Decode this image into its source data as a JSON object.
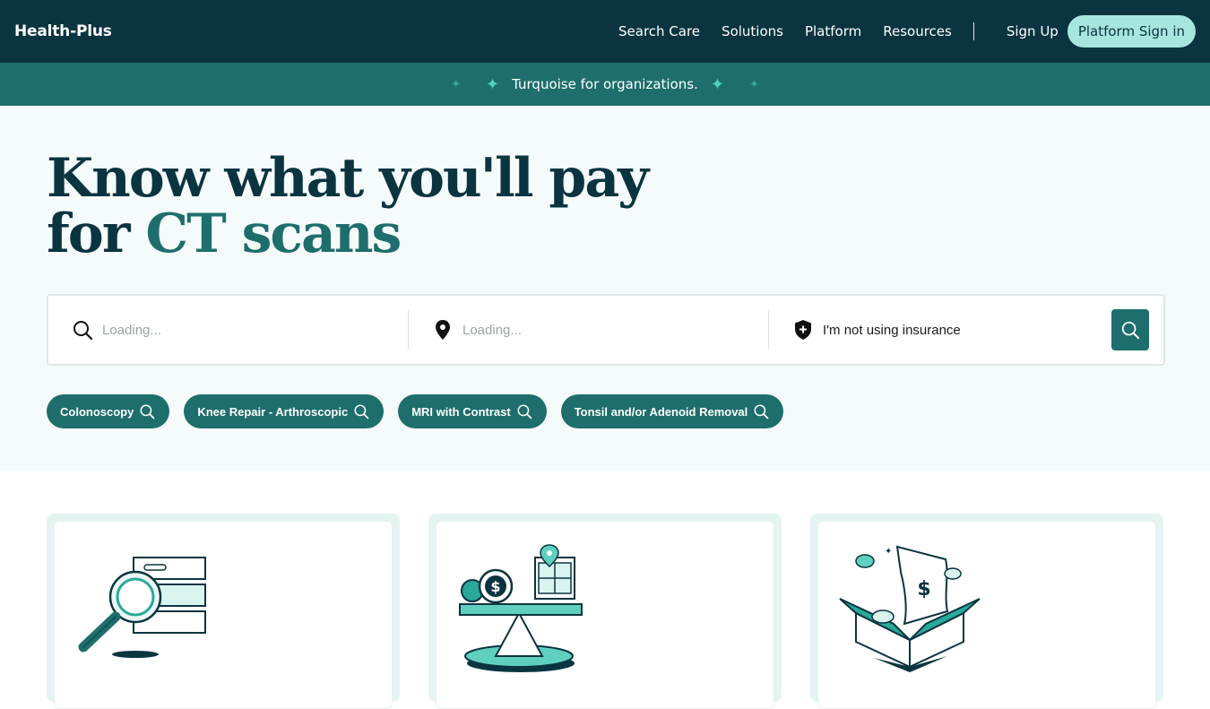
{
  "nav": {
    "brand": "Health-Plus",
    "links": [
      "Search Care",
      "Solutions",
      "Platform",
      "Resources"
    ],
    "signup": "Sign Up",
    "signin": "Platform Sign in"
  },
  "banner": {
    "text": "Turquoise for organizations."
  },
  "hero": {
    "headline_line1": "Know what you'll pay",
    "headline_for": "for",
    "headline_accent": "CT scans"
  },
  "search": {
    "service_placeholder": "Loading...",
    "location_placeholder": "Loading...",
    "insurance_text": "I'm not using insurance"
  },
  "chips": [
    "Colonoscopy",
    "Knee Repair - Arthroscopic",
    "MRI with Contrast",
    "Tonsil and/or Adenoid Removal"
  ],
  "cards": [
    {
      "icon": "magnifier-database-icon"
    },
    {
      "icon": "price-scale-icon"
    },
    {
      "icon": "money-box-icon"
    }
  ],
  "colors": {
    "nav_bg": "#0a3440",
    "banner_bg": "#1d6e6c",
    "accent": "#1d6e6c",
    "signin_bg": "#a6e6de",
    "hero_bg": "#f5fbfb"
  }
}
